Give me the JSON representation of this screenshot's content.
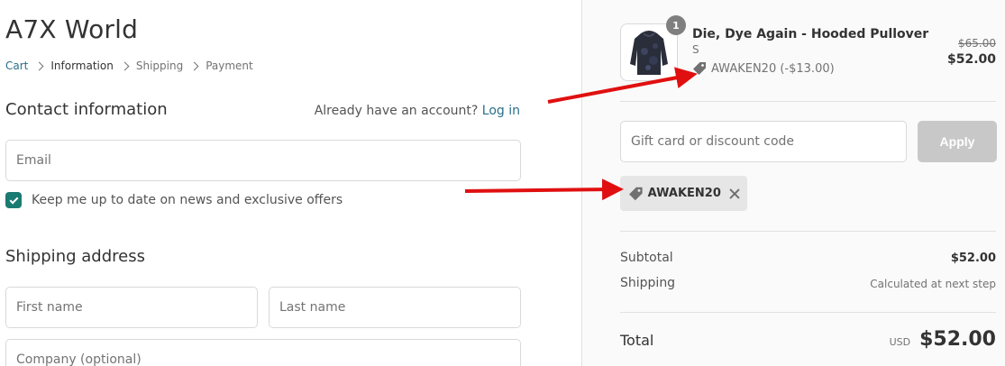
{
  "store": {
    "name": "A7X World"
  },
  "breadcrumb": {
    "items": [
      "Cart",
      "Information",
      "Shipping",
      "Payment"
    ]
  },
  "contact": {
    "title": "Contact information",
    "account_prompt": "Already have an account?",
    "login_link": "Log in",
    "email_placeholder": "Email",
    "newsletter_label": "Keep me up to date on news and exclusive offers",
    "newsletter_checked": true
  },
  "shipping": {
    "title": "Shipping address",
    "first_name_placeholder": "First name",
    "last_name_placeholder": "Last name",
    "company_placeholder": "Company (optional)"
  },
  "cart": {
    "item": {
      "quantity": "1",
      "name": "Die, Dye Again - Hooded Pullover",
      "variant": "S",
      "discount": "AWAKEN20 (-$13.00)",
      "original_price": "$65.00",
      "final_price": "$52.00"
    },
    "discount_placeholder": "Gift card or discount code",
    "apply_label": "Apply",
    "applied_code": "AWAKEN20",
    "subtotal_label": "Subtotal",
    "subtotal_value": "$52.00",
    "shipping_label": "Shipping",
    "shipping_value": "Calculated at next step",
    "total_label": "Total",
    "total_currency": "USD",
    "total_value": "$52.00"
  },
  "colors": {
    "accent": "#1a7b72",
    "link": "#2a6f8a",
    "arrow": "#e01010",
    "apply_disabled": "#c8c8c8"
  },
  "icons": [
    "tag-icon",
    "checkmark-icon",
    "chevron-right-icon",
    "close-icon",
    "hoodie-thumbnail"
  ]
}
